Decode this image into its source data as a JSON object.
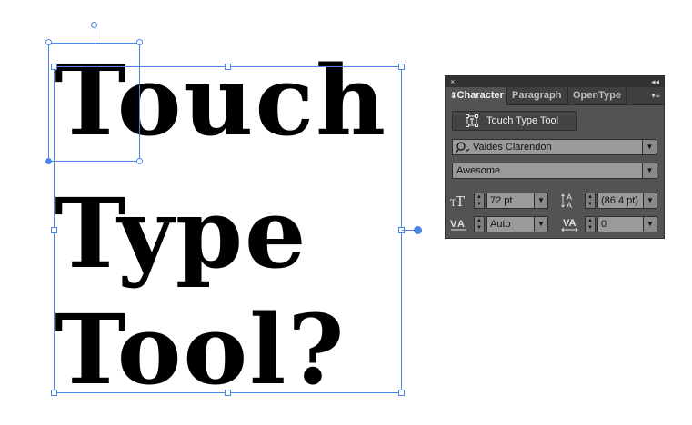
{
  "canvas": {
    "lines": [
      "Touch",
      "Type",
      "Tool?"
    ],
    "selection_color": "#4a86e8",
    "text_color": "#000000"
  },
  "panel": {
    "close_glyph": "×",
    "collapse_glyph": "◂◂",
    "tabs": [
      {
        "label": "Character",
        "active": true
      },
      {
        "label": "Paragraph",
        "active": false
      },
      {
        "label": "OpenType",
        "active": false
      }
    ],
    "tab_sort_glyph": "⇕",
    "menu_glyph": "▾≡",
    "touch_type_button": {
      "label": "Touch Type Tool",
      "icon": "touch-type-icon"
    },
    "font_family": {
      "value": "Valdes Clarendon",
      "icon": "search-icon"
    },
    "font_style": {
      "value": "Awesome"
    },
    "font_size": {
      "value": "72 pt",
      "icon": "font-size-icon"
    },
    "leading": {
      "value": "(86.4 pt)",
      "icon": "leading-icon"
    },
    "kerning": {
      "value": "Auto",
      "icon": "kerning-icon"
    },
    "tracking": {
      "value": "0",
      "icon": "tracking-icon"
    },
    "dropdown_glyph": "▼",
    "stepper_up": "▲",
    "stepper_down": "▼",
    "background_color": "#535353"
  }
}
